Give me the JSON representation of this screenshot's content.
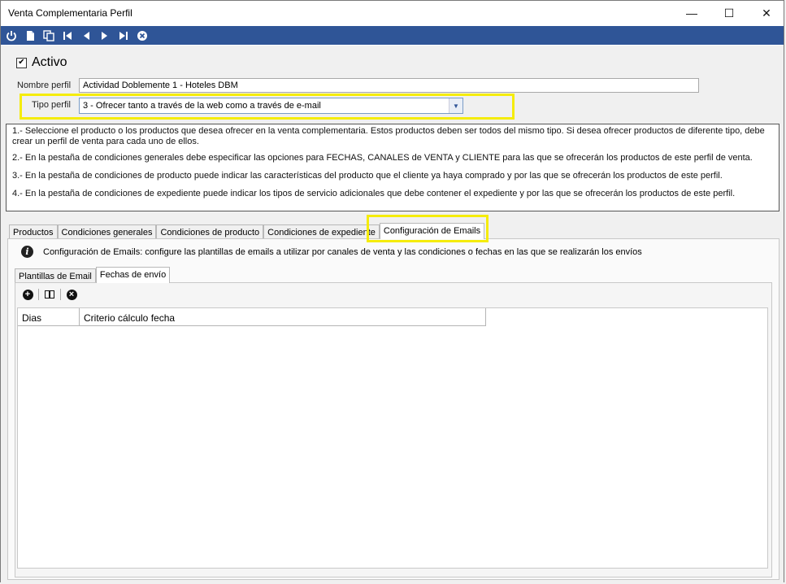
{
  "window": {
    "title": "Venta Complementaria Perfil",
    "controls": {
      "minimize": "—",
      "maximize": "☐",
      "close": "✕"
    }
  },
  "toolbar": {
    "buttons": [
      "power-icon",
      "new-document-icon",
      "copy-icon",
      "first-record-icon",
      "previous-icon",
      "next-icon",
      "last-record-icon",
      "cancel-icon"
    ],
    "accent_color": "#2f5597"
  },
  "form": {
    "activo_label": "Activo",
    "activo_checked": true,
    "check_mark": "✔",
    "nombre_label": "Nombre perfil",
    "nombre_value": "Actividad Doblemente 1 - Hoteles DBM",
    "tipo_label": "Tipo perfil",
    "tipo_value": "3 - Ofrecer tanto a través de la web como a través de e-mail",
    "dropdown_arrow": "▼",
    "highlight_color": "#f5ec0a"
  },
  "instructions": [
    "1.-  Seleccione el producto o los productos que desea ofrecer en la venta complementaria. Estos productos deben ser todos del mismo tipo. Si desea ofrecer productos de diferente tipo, debe crear un perfil de venta para cada uno de ellos.",
    "2.- En la pestaña de condiciones generales debe especificar las opciones para FECHAS, CANALES de VENTA y CLIENTE para las que se ofrecerán los productos de este perfil de venta.",
    "3.- En la pestaña de condiciones de producto puede indicar las características del producto que el cliente ya haya comprado y por las que se ofrecerán los productos de este perfil.",
    "4.- En la pestaña de condiciones de expediente puede indicar los tipos de servicio adicionales que debe contener el expediente y por las que se ofrecerán los productos de este perfil."
  ],
  "tabs": [
    {
      "label": "Productos",
      "active": false
    },
    {
      "label": "Condiciones generales",
      "active": false
    },
    {
      "label": "Condiciones de producto",
      "active": false
    },
    {
      "label": "Condiciones de expediente",
      "active": false
    },
    {
      "label": "Configuración de Emails",
      "active": true
    }
  ],
  "email_config": {
    "info_icon": "i",
    "description": "Configuración de Emails: configure las plantillas de emails a utilizar por canales de venta y las condiciones o fechas en las que se realizarán los envíos",
    "sub_tabs": [
      {
        "label": "Plantillas de Email",
        "active": false
      },
      {
        "label": "Fechas de envío",
        "active": true
      }
    ],
    "grid_toolbar": {
      "add_symbol": "+",
      "cancel_symbol": "×"
    },
    "grid": {
      "columns": [
        "Dias",
        "Criterio cálculo fecha"
      ],
      "rows": []
    }
  }
}
